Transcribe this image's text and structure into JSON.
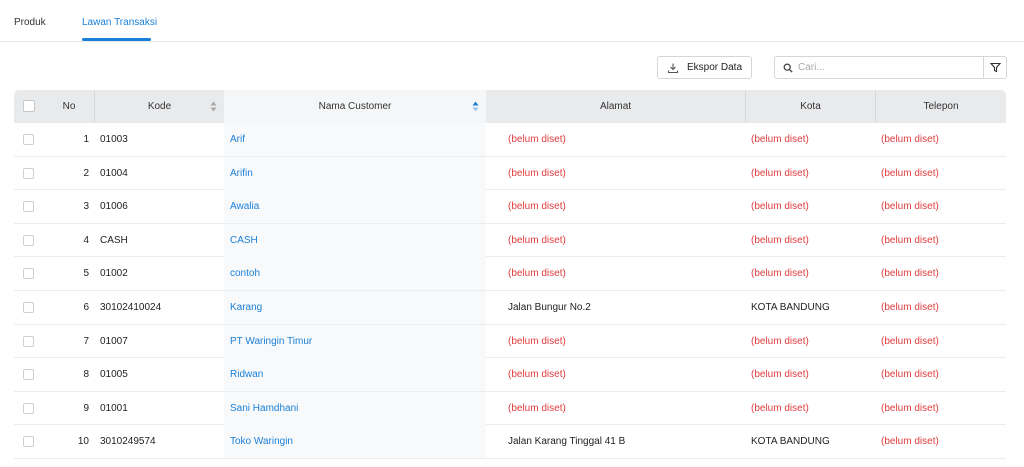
{
  "tabs": [
    {
      "label": "Produk",
      "active": false
    },
    {
      "label": "Lawan Transaksi",
      "active": true
    }
  ],
  "toolbar": {
    "export_label": "Ekspor Data",
    "search_placeholder": "Cari...",
    "search_value": ""
  },
  "table": {
    "columns": {
      "no": "No",
      "kode": "Kode",
      "nama": "Nama Customer",
      "alamat": "Alamat",
      "kota": "Kota",
      "telepon": "Telepon"
    },
    "rows": [
      {
        "no": "1",
        "kode": "01003",
        "nama": "Arif",
        "alamat": "(belum diset)",
        "kota": "(belum diset)",
        "telepon": "(belum diset)"
      },
      {
        "no": "2",
        "kode": "01004",
        "nama": "Arifin",
        "alamat": "(belum diset)",
        "kota": "(belum diset)",
        "telepon": "(belum diset)"
      },
      {
        "no": "3",
        "kode": "01006",
        "nama": "Awalia",
        "alamat": "(belum diset)",
        "kota": "(belum diset)",
        "telepon": "(belum diset)"
      },
      {
        "no": "4",
        "kode": "CASH",
        "nama": "CASH",
        "alamat": "(belum diset)",
        "kota": "(belum diset)",
        "telepon": "(belum diset)"
      },
      {
        "no": "5",
        "kode": "01002",
        "nama": "contoh",
        "alamat": "(belum diset)",
        "kota": "(belum diset)",
        "telepon": "(belum diset)"
      },
      {
        "no": "6",
        "kode": "30102410024",
        "nama": "Karang",
        "alamat": "Jalan Bungur No.2",
        "kota": "KOTA BANDUNG",
        "telepon": "(belum diset)"
      },
      {
        "no": "7",
        "kode": "01007",
        "nama": "PT Waringin Timur",
        "alamat": "(belum diset)",
        "kota": "(belum diset)",
        "telepon": "(belum diset)"
      },
      {
        "no": "8",
        "kode": "01005",
        "nama": "Ridwan",
        "alamat": "(belum diset)",
        "kota": "(belum diset)",
        "telepon": "(belum diset)"
      },
      {
        "no": "9",
        "kode": "01001",
        "nama": "Sani Hamdhani",
        "alamat": "(belum diset)",
        "kota": "(belum diset)",
        "telepon": "(belum diset)"
      },
      {
        "no": "10",
        "kode": "3010249574",
        "nama": "Toko Waringin",
        "alamat": "Jalan Karang Tinggal 41 B",
        "kota": "KOTA BANDUNG",
        "telepon": "(belum diset)"
      }
    ]
  },
  "colors": {
    "accent": "#1a7fd8",
    "unset_text": "#e03c3c",
    "header_bg": "#e9eaec"
  },
  "icons": {
    "export": "download-icon",
    "search": "search-icon",
    "filter": "filter-icon",
    "sort": "sort-icon"
  }
}
